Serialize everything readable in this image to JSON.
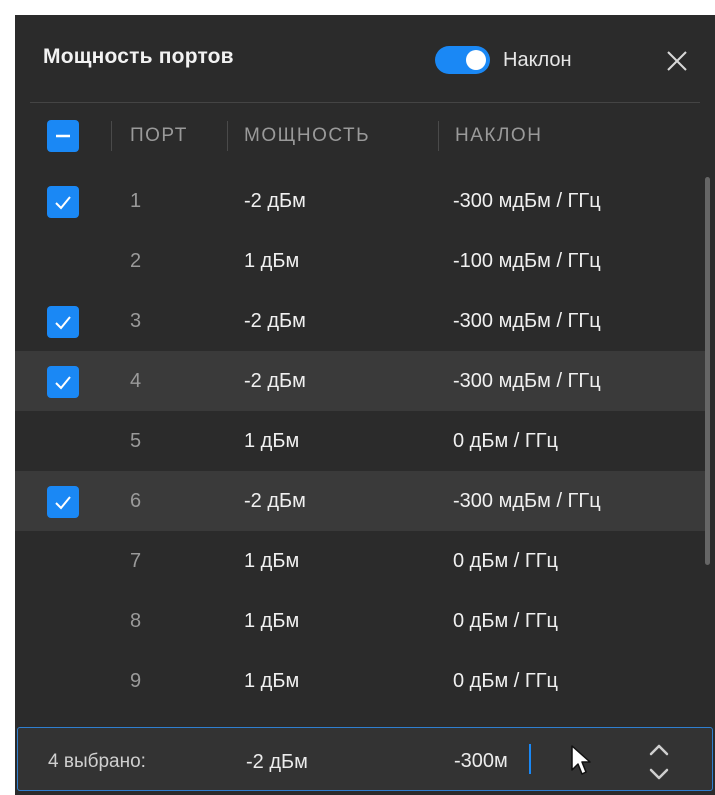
{
  "dialog": {
    "title": "Мощность портов",
    "toggle_label": "Наклон",
    "toggle_on": true
  },
  "columns": {
    "port": "ПОРТ",
    "power": "МОЩНОСТЬ",
    "slope": "НАКЛОН"
  },
  "rows": [
    {
      "port": "1",
      "power": "-2 дБм",
      "slope": "-300 мдБм / ГГц",
      "checked": true
    },
    {
      "port": "2",
      "power": "1 дБм",
      "slope": "-100 мдБм / ГГц",
      "checked": false
    },
    {
      "port": "3",
      "power": "-2 дБм",
      "slope": "-300 мдБм / ГГц",
      "checked": true
    },
    {
      "port": "4",
      "power": "-2 дБм",
      "slope": "-300 мдБм / ГГц",
      "checked": true
    },
    {
      "port": "5",
      "power": "1 дБм",
      "slope": "0 дБм / ГГц",
      "checked": false
    },
    {
      "port": "6",
      "power": "-2 дБм",
      "slope": "-300 мдБм / ГГц",
      "checked": true
    },
    {
      "port": "7",
      "power": "1 дБм",
      "slope": "0 дБм / ГГц",
      "checked": false
    },
    {
      "port": "8",
      "power": "1 дБм",
      "slope": "0 дБм / ГГц",
      "checked": false
    },
    {
      "port": "9",
      "power": "1 дБм",
      "slope": "0 дБм / ГГц",
      "checked": false
    }
  ],
  "footer": {
    "selected_label": "4 выбрано:",
    "power": "-2 дБм",
    "slope_input": "-300м"
  },
  "colors": {
    "accent": "#1a88f5",
    "background": "#2b2b2b",
    "row_highlight": "#3a3a3a"
  },
  "icons": {
    "close": "close-icon",
    "check": "check-icon",
    "indeterminate": "minus-icon",
    "stepper": "chevron-up-down-icon"
  }
}
